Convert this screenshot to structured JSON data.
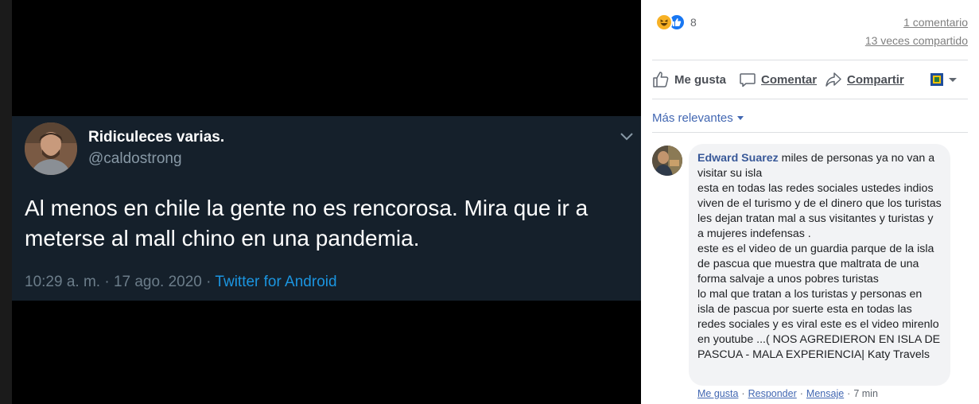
{
  "tweet": {
    "display_name": "Ridiculeces varias.",
    "handle": "@caldostrong",
    "text": "Al menos en chile la gente no es rencorosa. Mira que ir a meterse al mall chino en una pandemia.",
    "time": "10:29 a. m. · 17 ago. 2020 · ",
    "source": "Twitter for Android"
  },
  "post_stats": {
    "reaction_count": "8",
    "comments": "1 comentario",
    "shares": "13 veces compartido"
  },
  "actions": {
    "like": "Me gusta",
    "comment": "Comentar",
    "share": "Compartir"
  },
  "comments_filter": "Más relevantes",
  "comment": {
    "author": "Edward Suarez",
    "text": " miles de personas ya no van a visitar su isla\nesta en todas las redes sociales ustedes indios viven de el turismo y de el dinero que los turistas les dejan tratan mal a sus visitantes y turistas y a mujeres indefensas .\neste es el video de un guardia parque de la isla de pascua que muestra que maltrata de una forma salvaje a unos pobres turistas\nlo mal que tratan a los turistas y personas en isla de pascua por suerte esta en todas las redes sociales y es viral este es el video mirenlo en youtube ...( NOS AGREDIERON EN ISLA DE PASCUA - MALA EXPERIENCIA| Katy Travels",
    "like": "Me gusta",
    "reply": "Responder",
    "message": "Mensaje",
    "time": "7 min"
  },
  "colors": {
    "twitter_bg": "#15202b",
    "twitter_link": "#1b95e0",
    "fb_link": "#4267b2",
    "fb_author": "#385898"
  },
  "icons": [
    "chevron-down-icon",
    "haha-reaction-icon",
    "like-reaction-icon",
    "thumbs-up-icon",
    "comment-icon",
    "share-icon",
    "page-avatar-icon",
    "caret-down-icon"
  ]
}
